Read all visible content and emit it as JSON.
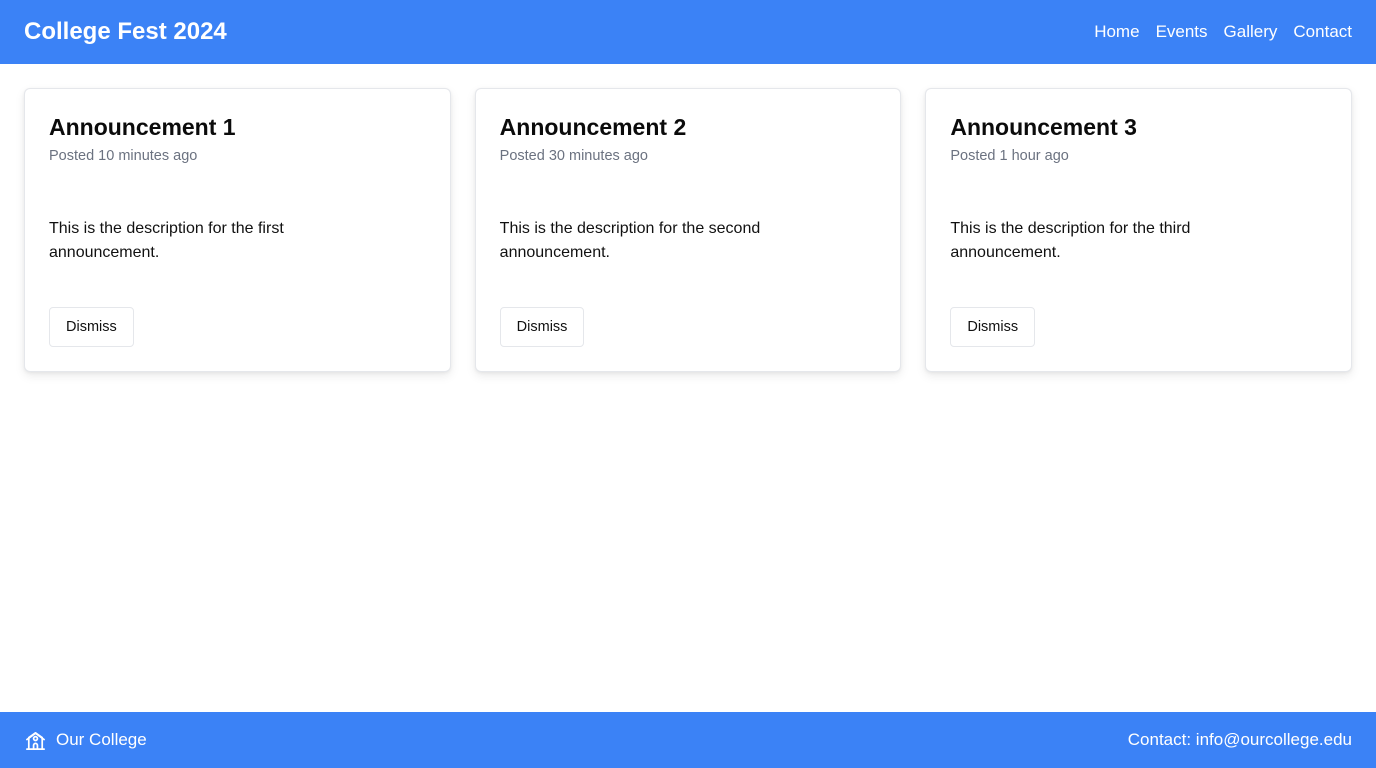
{
  "header": {
    "title": "College Fest 2024",
    "nav": [
      "Home",
      "Events",
      "Gallery",
      "Contact"
    ]
  },
  "cards": [
    {
      "title": "Announcement 1",
      "meta": "Posted 10 minutes ago",
      "description": "This is the description for the first announcement.",
      "button": "Dismiss"
    },
    {
      "title": "Announcement 2",
      "meta": "Posted 30 minutes ago",
      "description": "This is the description for the second announcement.",
      "button": "Dismiss"
    },
    {
      "title": "Announcement 3",
      "meta": "Posted 1 hour ago",
      "description": "This is the description for the third announcement.",
      "button": "Dismiss"
    }
  ],
  "footer": {
    "icon": "school-building-icon",
    "college": "Our College",
    "contact": "Contact: info@ourcollege.edu"
  },
  "colors": {
    "brand": "#3b82f6",
    "muted_text": "#6b7280",
    "card_border": "#e5e7eb"
  }
}
